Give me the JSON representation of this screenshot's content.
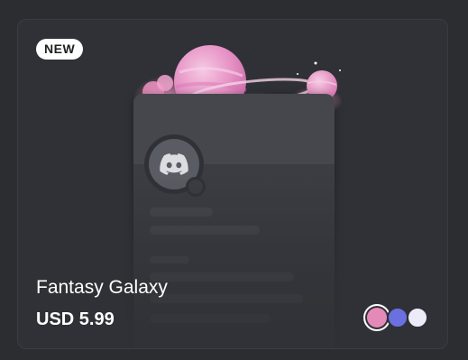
{
  "card": {
    "badge_label": "NEW",
    "title": "Fantasy Galaxy",
    "price": "USD 5.99",
    "accent_colors": {
      "planet": "#e898c8",
      "planet_light": "#f5c4e0",
      "cloud": "#ec8cc0"
    },
    "swatches": [
      {
        "color": "#e58ab8",
        "selected": true
      },
      {
        "color": "#6b6fe0",
        "selected": false
      },
      {
        "color": "#ecebf7",
        "selected": false
      }
    ],
    "preview_icon": "discord-logo-icon"
  }
}
